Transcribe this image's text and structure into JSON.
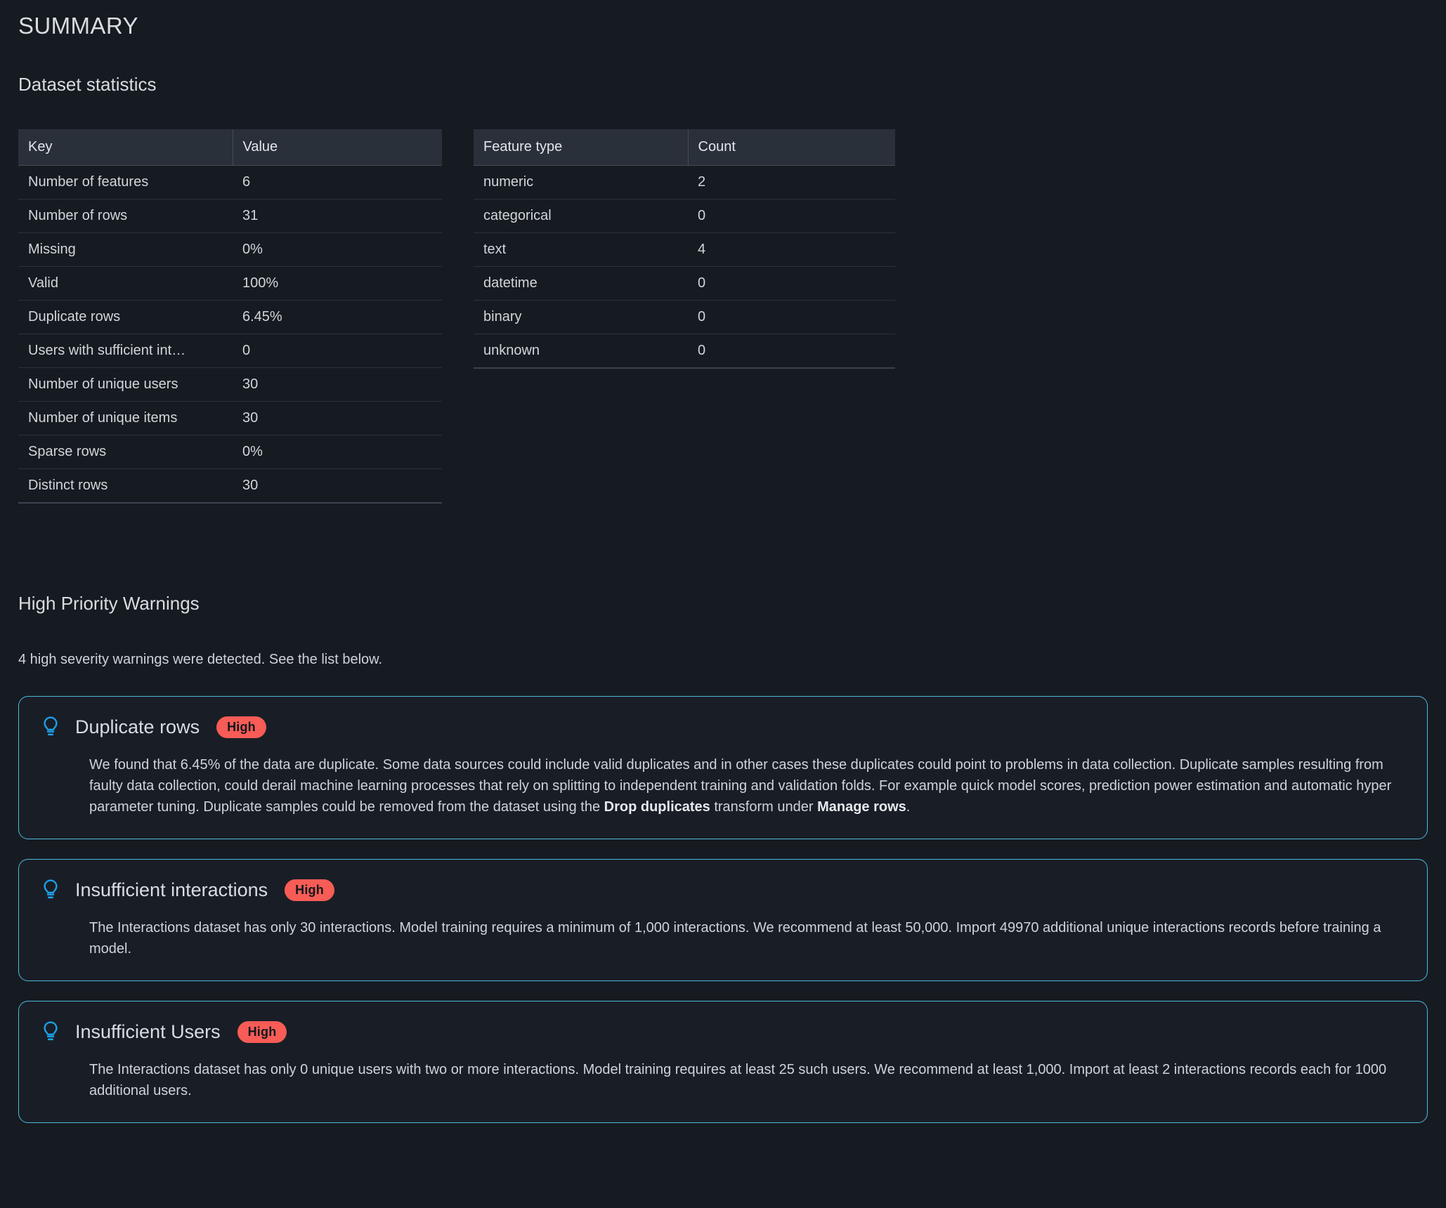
{
  "page": {
    "title": "SUMMARY",
    "dataset_statistics_heading": "Dataset statistics",
    "warnings_heading": "High Priority Warnings",
    "warnings_note": "4 high severity warnings were detected. See the list below.",
    "accent_border": "#4fb9dd",
    "bulb_icon_color": "#1ca0e8",
    "badge_color": "#f75c56",
    "background": "#161b22"
  },
  "stats_table": {
    "headers": [
      "Key",
      "Value"
    ],
    "rows": [
      {
        "key": "Number of features",
        "value": "6"
      },
      {
        "key": "Number of rows",
        "value": "31"
      },
      {
        "key": "Missing",
        "value": "0%"
      },
      {
        "key": "Valid",
        "value": "100%"
      },
      {
        "key": "Duplicate rows",
        "value": "6.45%"
      },
      {
        "key": "Users with sufficient int…",
        "value": "0"
      },
      {
        "key": "Number of unique users",
        "value": "30"
      },
      {
        "key": "Number of unique items",
        "value": "30"
      },
      {
        "key": "Sparse rows",
        "value": "0%"
      },
      {
        "key": "Distinct rows",
        "value": "30"
      }
    ]
  },
  "feature_table": {
    "headers": [
      "Feature type",
      "Count"
    ],
    "rows": [
      {
        "key": "numeric",
        "value": "2"
      },
      {
        "key": "categorical",
        "value": "0"
      },
      {
        "key": "text",
        "value": "4"
      },
      {
        "key": "datetime",
        "value": "0"
      },
      {
        "key": "binary",
        "value": "0"
      },
      {
        "key": "unknown",
        "value": "0"
      }
    ]
  },
  "warnings": [
    {
      "icon": "lightbulb-icon",
      "title": "Duplicate rows",
      "severity": "High",
      "body_parts": [
        {
          "text": "We found that 6.45% of the data are duplicate. Some data sources could include valid duplicates and in other cases these duplicates could point to problems in data collection. Duplicate samples resulting from faulty data collection, could derail machine learning processes that rely on splitting to independent training and validation folds. For example quick model scores, prediction power estimation and automatic hyper parameter tuning. Duplicate samples could be removed from the dataset using the ",
          "bold": false
        },
        {
          "text": "Drop duplicates",
          "bold": true
        },
        {
          "text": " transform under ",
          "bold": false
        },
        {
          "text": "Manage rows",
          "bold": true
        },
        {
          "text": ".",
          "bold": false
        }
      ]
    },
    {
      "icon": "lightbulb-icon",
      "title": "Insufficient interactions",
      "severity": "High",
      "body_parts": [
        {
          "text": "The Interactions dataset has only 30 interactions. Model training requires a minimum of 1,000 interactions. We recommend at least 50,000. Import 49970 additional unique interactions records before training a model.",
          "bold": false
        }
      ]
    },
    {
      "icon": "lightbulb-icon",
      "title": "Insufficient Users",
      "severity": "High",
      "body_parts": [
        {
          "text": "The Interactions dataset has only 0 unique users with two or more interactions. Model training requires at least 25 such users. We recommend at least 1,000. Import at least 2 interactions records each for 1000 additional users.",
          "bold": false
        }
      ]
    }
  ]
}
